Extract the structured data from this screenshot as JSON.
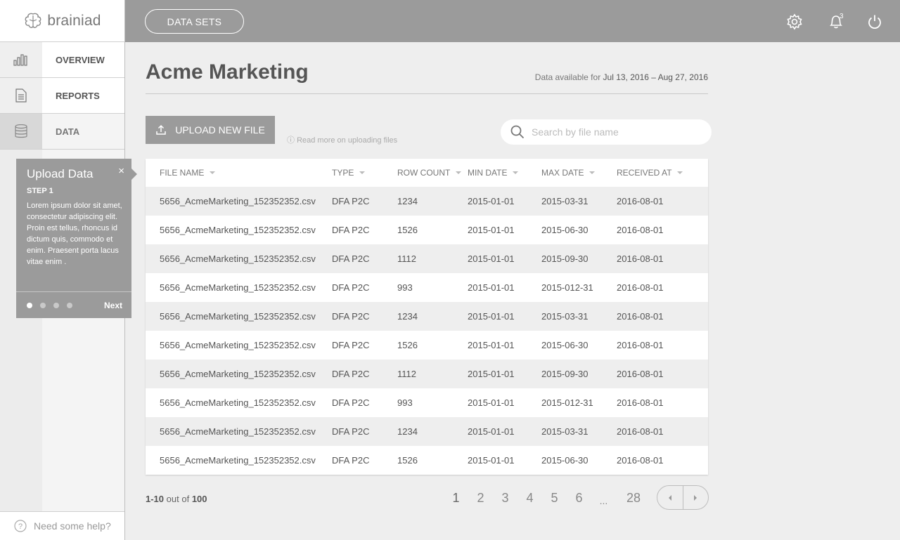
{
  "brand": {
    "name": "brainiad"
  },
  "sidebar": {
    "items": [
      {
        "label": "OVERVIEW",
        "icon": "bar-chart-icon"
      },
      {
        "label": "REPORTS",
        "icon": "document-icon"
      },
      {
        "label": "DATA",
        "icon": "database-icon",
        "active": true
      }
    ],
    "help": "Need some help?"
  },
  "popover": {
    "title": "Upload Data",
    "close": "×",
    "step": "STEP 1",
    "body": "Lorem ipsum dolor sit amet, consectetur adipiscing elit. Proin est tellus, rhoncus id dictum quis, commodo et enim. Praesent porta lacus vitae enim .",
    "next": "Next",
    "current_step": 1,
    "total_steps": 4
  },
  "topbar": {
    "datasets_button": "DATA SETS",
    "notification_count": "3"
  },
  "main": {
    "title": "Acme Marketing",
    "availability_label": "Data available for",
    "availability_range": "Jul 13, 2016 – Aug 27, 2016",
    "upload_button": "UPLOAD NEW FILE",
    "read_more": "Read more on uploading files",
    "search_placeholder": "Search by file name"
  },
  "table": {
    "headers": [
      "FILE NAME",
      "TYPE",
      "ROW COUNT",
      "MIN DATE",
      "MAX DATE",
      "RECEIVED AT"
    ],
    "rows": [
      [
        "5656_AcmeMarketing_152352352.csv",
        "DFA P2C",
        "1234",
        "2015-01-01",
        "2015-03-31",
        "2016-08-01"
      ],
      [
        "5656_AcmeMarketing_152352352.csv",
        "DFA P2C",
        "1526",
        "2015-01-01",
        "2015-06-30",
        "2016-08-01"
      ],
      [
        "5656_AcmeMarketing_152352352.csv",
        "DFA P2C",
        "1112",
        "2015-01-01",
        "2015-09-30",
        "2016-08-01"
      ],
      [
        "5656_AcmeMarketing_152352352.csv",
        "DFA P2C",
        "993",
        "2015-01-01",
        "2015-012-31",
        "2016-08-01"
      ],
      [
        "5656_AcmeMarketing_152352352.csv",
        "DFA P2C",
        "1234",
        "2015-01-01",
        "2015-03-31",
        "2016-08-01"
      ],
      [
        "5656_AcmeMarketing_152352352.csv",
        "DFA P2C",
        "1526",
        "2015-01-01",
        "2015-06-30",
        "2016-08-01"
      ],
      [
        "5656_AcmeMarketing_152352352.csv",
        "DFA P2C",
        "1112",
        "2015-01-01",
        "2015-09-30",
        "2016-08-01"
      ],
      [
        "5656_AcmeMarketing_152352352.csv",
        "DFA P2C",
        "993",
        "2015-01-01",
        "2015-012-31",
        "2016-08-01"
      ],
      [
        "5656_AcmeMarketing_152352352.csv",
        "DFA P2C",
        "1234",
        "2015-01-01",
        "2015-03-31",
        "2016-08-01"
      ],
      [
        "5656_AcmeMarketing_152352352.csv",
        "DFA P2C",
        "1526",
        "2015-01-01",
        "2015-06-30",
        "2016-08-01"
      ]
    ]
  },
  "pagination": {
    "range": "1-10",
    "out_of": "out of",
    "total": "100",
    "pages": [
      "1",
      "2",
      "3",
      "4",
      "5",
      "6"
    ],
    "ellipsis": "...",
    "last_page": "28",
    "current": "1"
  }
}
